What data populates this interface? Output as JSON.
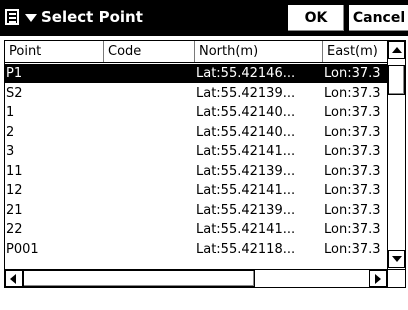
{
  "window": {
    "title": "Select Point",
    "menu_icon": "document-menu-icon",
    "ok_label": "OK",
    "cancel_label": "Cancel"
  },
  "table": {
    "columns": [
      "Point",
      "Code",
      "North(m)",
      "East(m)"
    ],
    "rows": [
      {
        "point": "P1",
        "code": "",
        "north": "Lat:55.42146...",
        "east": "Lon:37.3",
        "selected": true
      },
      {
        "point": "S2",
        "code": "",
        "north": "Lat:55.42139...",
        "east": "Lon:37.3"
      },
      {
        "point": "1",
        "code": "",
        "north": "Lat:55.42140...",
        "east": "Lon:37.3"
      },
      {
        "point": "2",
        "code": "",
        "north": "Lat:55.42140...",
        "east": "Lon:37.3"
      },
      {
        "point": "3",
        "code": "",
        "north": "Lat:55.42141...",
        "east": "Lon:37.3"
      },
      {
        "point": "11",
        "code": "",
        "north": "Lat:55.42139...",
        "east": "Lon:37.3"
      },
      {
        "point": "12",
        "code": "",
        "north": "Lat:55.42141...",
        "east": "Lon:37.3"
      },
      {
        "point": "21",
        "code": "",
        "north": "Lat:55.42139...",
        "east": "Lon:37.3"
      },
      {
        "point": "22",
        "code": "",
        "north": "Lat:55.42141...",
        "east": "Lon:37.3"
      },
      {
        "point": "P001",
        "code": "",
        "north": "Lat:55.42118...",
        "east": "Lon:37.3"
      }
    ]
  },
  "colors": {
    "titlebar_bg": "#000000",
    "selection_bg": "#000000",
    "selection_fg": "#ffffff"
  }
}
